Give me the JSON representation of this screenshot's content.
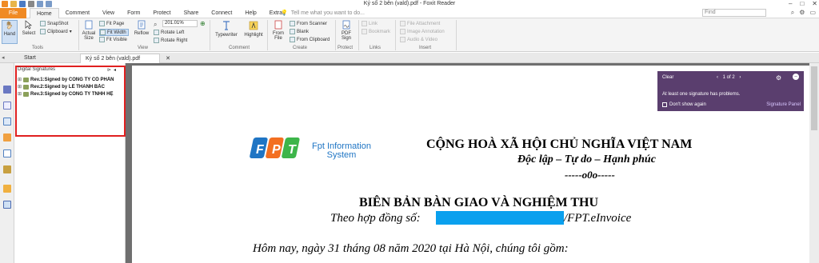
{
  "window": {
    "title": "Ký số 2 bên (vald).pdf - Foxit Reader"
  },
  "menu": {
    "file": "File",
    "tabs": [
      "Home",
      "Comment",
      "View",
      "Form",
      "Protect",
      "Share",
      "Connect",
      "Help",
      "Extras"
    ],
    "tell_me": "Tell me what you want to do...",
    "find_placeholder": "Find"
  },
  "ribbon": {
    "hand": "Hand",
    "select": "Select",
    "snapshot": "SnapShot",
    "clipboard": "Clipboard",
    "actual_size": "Actual Size",
    "fit_page": "Fit Page",
    "fit_width": "Fit Width",
    "fit_visible": "Fit Visible",
    "reflow": "Reflow",
    "zoom": "201.01%",
    "rotate_left": "Rotate Left",
    "rotate_right": "Rotate Right",
    "typewriter": "Typewriter",
    "highlight": "Highlight",
    "from_file": "From File",
    "from_scanner": "From Scanner",
    "blank": "Blank",
    "from_clipboard": "From Clipboard",
    "pdf_sign": "PDF Sign",
    "link": "Link",
    "bookmark": "Bookmark",
    "file_attachment": "File Attachment",
    "image_annotation": "Image Annotation",
    "audio_video": "Audio & Video",
    "groups": {
      "tools": "Tools",
      "view": "View",
      "comment": "Comment",
      "create": "Create",
      "protect": "Protect",
      "links": "Links",
      "insert": "Insert"
    }
  },
  "doc_tabs": {
    "start": "Start",
    "file": "Ký số 2 bên (vald).pdf"
  },
  "signatures": {
    "title": "Digital Signatures",
    "rows": [
      "Rev.1:Signed by CÔNG TY CỔ PHẦN",
      "Rev.2:Signed by LÊ THANH BẮC",
      "Rev.3:Signed by CÔNG TY TNHH HỆ"
    ]
  },
  "notification": {
    "clear": "Clear",
    "pager": "1 of 2",
    "message": "At least one signature has problems.",
    "dont_show": "Don't show again",
    "signature_panel": "Signature Panel"
  },
  "document": {
    "logo_line1": "Fpt Information",
    "logo_line2": "System",
    "country": "CỘNG HOÀ XÃ HỘI CHỦ NGHĨA VIỆT NAM",
    "motto": "Độc lập – Tự do – Hạnh phúc",
    "ornament": "-----o0o-----",
    "title": "BIÊN BẢN BÀN GIAO VÀ NGHIỆM THU",
    "contract_prefix": "Theo hợp đồng số:",
    "contract_suffix": "/FPT.eInvoice",
    "intro": "Hôm nay, ngày 31 tháng 08 năm 2020 tại Hà Nội, chúng tôi gồm:"
  },
  "colors": {
    "file_tab": "#f08a24",
    "notification_bg": "#5a3e6e",
    "highlight_border": "#e02020",
    "redaction": "#0aa0ee"
  }
}
